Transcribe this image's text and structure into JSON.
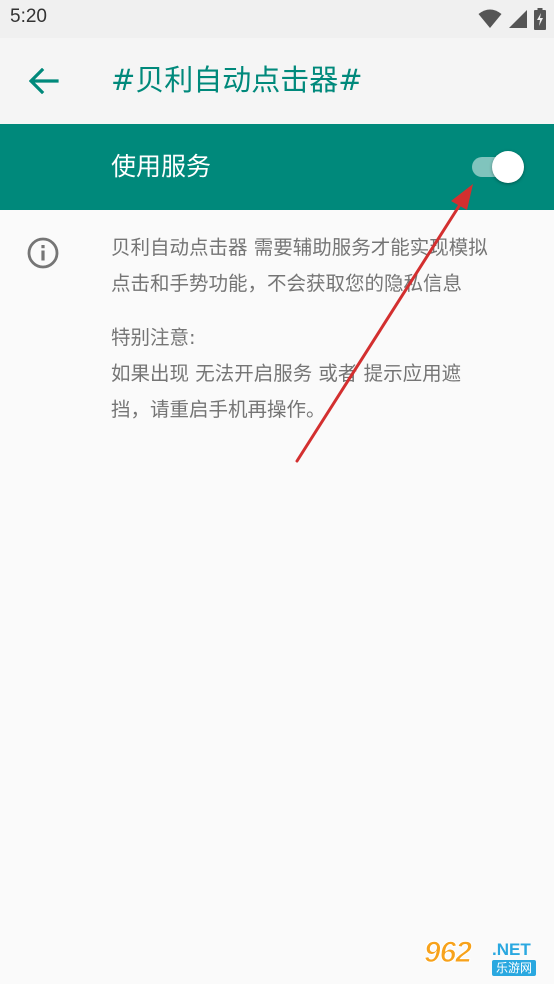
{
  "status_bar": {
    "time": "5:20",
    "icons": [
      "wifi-icon",
      "signal-icon",
      "battery-charging-icon"
    ]
  },
  "app_bar": {
    "back_icon": "arrow-left-icon",
    "title": "#贝利自动点击器#"
  },
  "service": {
    "label": "使用服务",
    "enabled": true
  },
  "info": {
    "icon": "info-icon",
    "paragraph_1": [
      "贝利自动点击器 需要辅助服务才能实现模拟",
      "点击和手势功能，不会获取您的隐私信息"
    ],
    "notice_heading": "特别注意:",
    "paragraph_2": [
      "如果出现 无法开启服务 或者 提示应用遮",
      "挡，请重启手机再操作。"
    ]
  },
  "watermark": {
    "number": "962",
    "domain": ".NET",
    "site_name": "乐游网"
  },
  "colors": {
    "primary": "#00897b",
    "background": "#fafafa",
    "text_secondary": "#757575",
    "annotation": "#d32f2f"
  }
}
